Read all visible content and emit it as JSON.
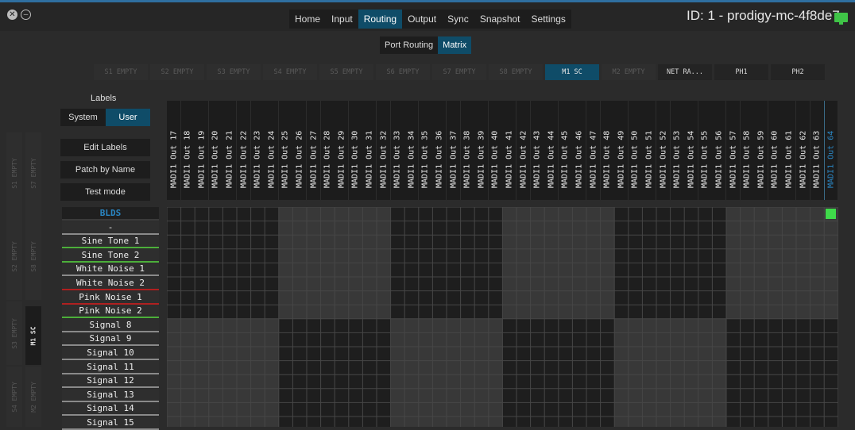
{
  "window": {
    "close_glyph": "✕",
    "minimize_glyph": "–",
    "device_id": "ID: 1 - prodigy-mc-4f8de7",
    "device_icon": "monitor-icon"
  },
  "nav": {
    "tabs": [
      {
        "label": "Home",
        "active": false
      },
      {
        "label": "Input",
        "active": false
      },
      {
        "label": "Routing",
        "active": true
      },
      {
        "label": "Output",
        "active": false
      },
      {
        "label": "Sync",
        "active": false
      },
      {
        "label": "Snapshot",
        "active": false
      },
      {
        "label": "Settings",
        "active": false
      }
    ]
  },
  "subtabs": [
    {
      "label": "Port Routing",
      "active": false
    },
    {
      "label": "Matrix",
      "active": true
    }
  ],
  "cards": [
    {
      "label": "S1 EMPTY",
      "state": "empty"
    },
    {
      "label": "S2 EMPTY",
      "state": "empty"
    },
    {
      "label": "S3 EMPTY",
      "state": "empty"
    },
    {
      "label": "S4 EMPTY",
      "state": "empty"
    },
    {
      "label": "S5 EMPTY",
      "state": "empty"
    },
    {
      "label": "S6 EMPTY",
      "state": "empty"
    },
    {
      "label": "S7 EMPTY",
      "state": "empty"
    },
    {
      "label": "S8 EMPTY",
      "state": "empty"
    },
    {
      "label": "M1 SC",
      "state": "active"
    },
    {
      "label": "M2 EMPTY",
      "state": "empty"
    },
    {
      "label": "NET RA...",
      "state": "avail"
    },
    {
      "label": "PH1",
      "state": "avail"
    },
    {
      "label": "PH2",
      "state": "avail"
    }
  ],
  "labels_panel": {
    "title": "Labels",
    "system_label": "System",
    "user_label": "User",
    "edit_labels": "Edit Labels",
    "patch_by_name": "Patch by Name",
    "test_mode": "Test mode"
  },
  "side_tabs": {
    "outer": [
      "S1 EMPTY",
      "S2 EMPTY",
      "S3 EMPTY",
      "S4 EMPTY"
    ],
    "inner": [
      "S7 EMPTY",
      "S8 EMPTY",
      "M1 SC",
      "M2 EMPTY"
    ]
  },
  "columns": [
    "MADI1 Out 17",
    "MADI1 Out 18",
    "MADI1 Out 19",
    "MADI1 Out 20",
    "MADI1 Out 21",
    "MADI1 Out 22",
    "MADI1 Out 23",
    "MADI1 Out 24",
    "MADI1 Out 25",
    "MADI1 Out 26",
    "MADI1 Out 27",
    "MADI1 Out 28",
    "MADI1 Out 29",
    "MADI1 Out 30",
    "MADI1 Out 31",
    "MADI1 Out 32",
    "MADI1 Out 33",
    "MADI1 Out 34",
    "MADI1 Out 35",
    "MADI1 Out 36",
    "MADI1 Out 37",
    "MADI1 Out 38",
    "MADI1 Out 39",
    "MADI1 Out 40",
    "MADI1 Out 41",
    "MADI1 Out 42",
    "MADI1 Out 43",
    "MADI1 Out 44",
    "MADI1 Out 45",
    "MADI1 Out 46",
    "MADI1 Out 47",
    "MADI1 Out 48",
    "MADI1 Out 49",
    "MADI1 Out 50",
    "MADI1 Out 51",
    "MADI1 Out 52",
    "MADI1 Out 53",
    "MADI1 Out 54",
    "MADI1 Out 55",
    "MADI1 Out 56",
    "MADI1 Out 57",
    "MADI1 Out 58",
    "MADI1 Out 59",
    "MADI1 Out 60",
    "MADI1 Out 61",
    "MADI1 Out 62",
    "MADI1 Out 63",
    "MADI1 Out 64"
  ],
  "highlighted_column": "MADI1 Out 64",
  "rows": [
    {
      "label": "BLDS",
      "accent": ""
    },
    {
      "label": "-",
      "accent": ""
    },
    {
      "label": "Sine Tone 1",
      "accent": "#4caf3a"
    },
    {
      "label": "Sine Tone 2",
      "accent": "#4caf3a"
    },
    {
      "label": "White Noise 1",
      "accent": "#8a8a8a"
    },
    {
      "label": "White Noise 2",
      "accent": "#b02020"
    },
    {
      "label": "Pink Noise 1",
      "accent": "#b02020"
    },
    {
      "label": "Pink Noise 2",
      "accent": "#4caf3a"
    },
    {
      "label": "Signal 8",
      "accent": ""
    },
    {
      "label": "Signal 9",
      "accent": ""
    },
    {
      "label": "Signal 10",
      "accent": ""
    },
    {
      "label": "Signal 11",
      "accent": ""
    },
    {
      "label": "Signal 12",
      "accent": ""
    },
    {
      "label": "Signal 13",
      "accent": ""
    },
    {
      "label": "Signal 14",
      "accent": ""
    },
    {
      "label": "Signal 15",
      "accent": ""
    }
  ],
  "connections": [
    {
      "row": "BLDS",
      "column": "MADI1 Out 64"
    }
  ],
  "colors": {
    "active_blue": "#0f4c68",
    "highlight_text": "#2a86c3",
    "connection_green": "#3fd94a",
    "grid_dark": "#1e1e1e",
    "grid_light": "#383838",
    "grid_line": "#464646"
  }
}
